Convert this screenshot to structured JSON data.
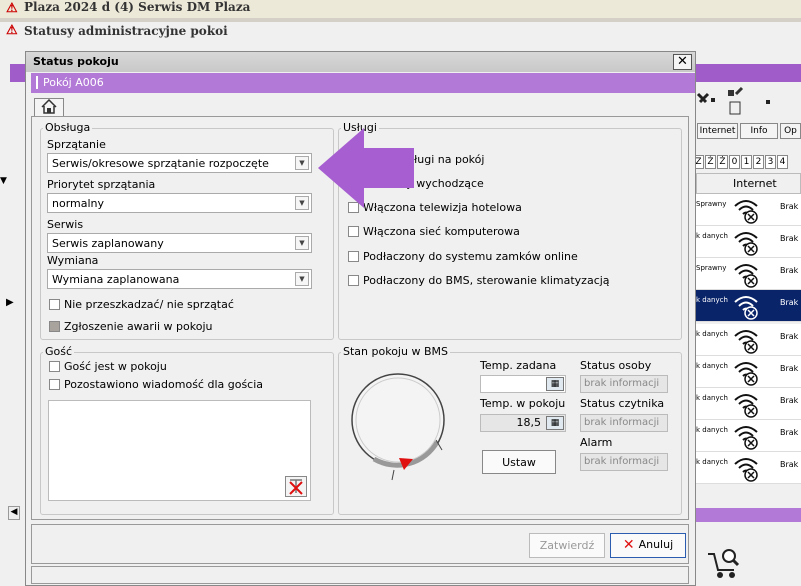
{
  "app": {
    "title": "Plaza 2024 d (4) Serwis DM Plaza",
    "subtitle": "Statusy administracyjne pokoi"
  },
  "background": {
    "tool_buttons": [
      "Internet",
      "Info",
      "Op"
    ],
    "alphabet": [
      "Z",
      "Ź",
      "Ż",
      "0",
      "1",
      "2",
      "3",
      "4"
    ],
    "column_header": "Internet",
    "rows": [
      {
        "status": "Sprawny",
        "value": "Brak"
      },
      {
        "status": "k danych",
        "value": "Brak"
      },
      {
        "status": "Sprawny",
        "value": "Brak"
      },
      {
        "status": "k danych",
        "value": "Brak"
      },
      {
        "status": "k danych",
        "value": "Brak"
      },
      {
        "status": "k danych",
        "value": "Brak"
      },
      {
        "status": "k danych",
        "value": "Brak"
      },
      {
        "status": "k danych",
        "value": "Brak"
      },
      {
        "status": "k danych",
        "value": "Brak"
      }
    ]
  },
  "dialog": {
    "title": "Status pokoju",
    "close_label": "✕",
    "room": "Pokój A006",
    "service": {
      "label": "Obsługa",
      "cleaning_label": "Sprzątanie",
      "cleaning_value": "Serwis/okresowe sprzątanie rozpoczęte",
      "priority_label": "Priorytet sprzątania",
      "priority_value": "normalny",
      "serwis_label": "Serwis",
      "serwis_value": "Serwis  zaplanowany",
      "exchange_label": "Wymiana",
      "exchange_value": "Wymiana zaplanowana",
      "dnd_label": "Nie przeszkadzać/ nie sprzątać",
      "failure_label": "Zgłoszenie awarii w pokoju"
    },
    "services": {
      "label": "Usługi",
      "items": [
        "esyłać usługi na pokój",
        "rozmowy wychodzące",
        "Włączona telewizja hotelowa",
        "Włączona sieć komputerowa",
        "Podłaczony do systemu zamków online",
        "Podłaczony do BMS, sterowanie klimatyzacją"
      ]
    },
    "guest": {
      "label": "Gość",
      "in_room_label": "Gość jest w pokoju",
      "message_label": "Pozostawiono wiadomość dla gościa"
    },
    "bms": {
      "label": "Stan pokoju w BMS",
      "temp_set_label": "Temp. zadana",
      "temp_room_label": "Temp. w pokoju",
      "temp_room_value": "18,5",
      "set_button": "Ustaw",
      "person_status_label": "Status osoby",
      "person_status_value": "brak informacji",
      "reader_status_label": "Status czytnika",
      "reader_status_value": "brak informacji",
      "alarm_label": "Alarm",
      "alarm_value": "brak informacji"
    },
    "footer": {
      "confirm_label": "Zatwierdź",
      "cancel_label": "Anuluj"
    }
  },
  "colors": {
    "accent_purple": "#b279d6",
    "arrow_purple": "#a65ed0",
    "selection": "#0a246a",
    "cancel_icon": "#e01010"
  }
}
